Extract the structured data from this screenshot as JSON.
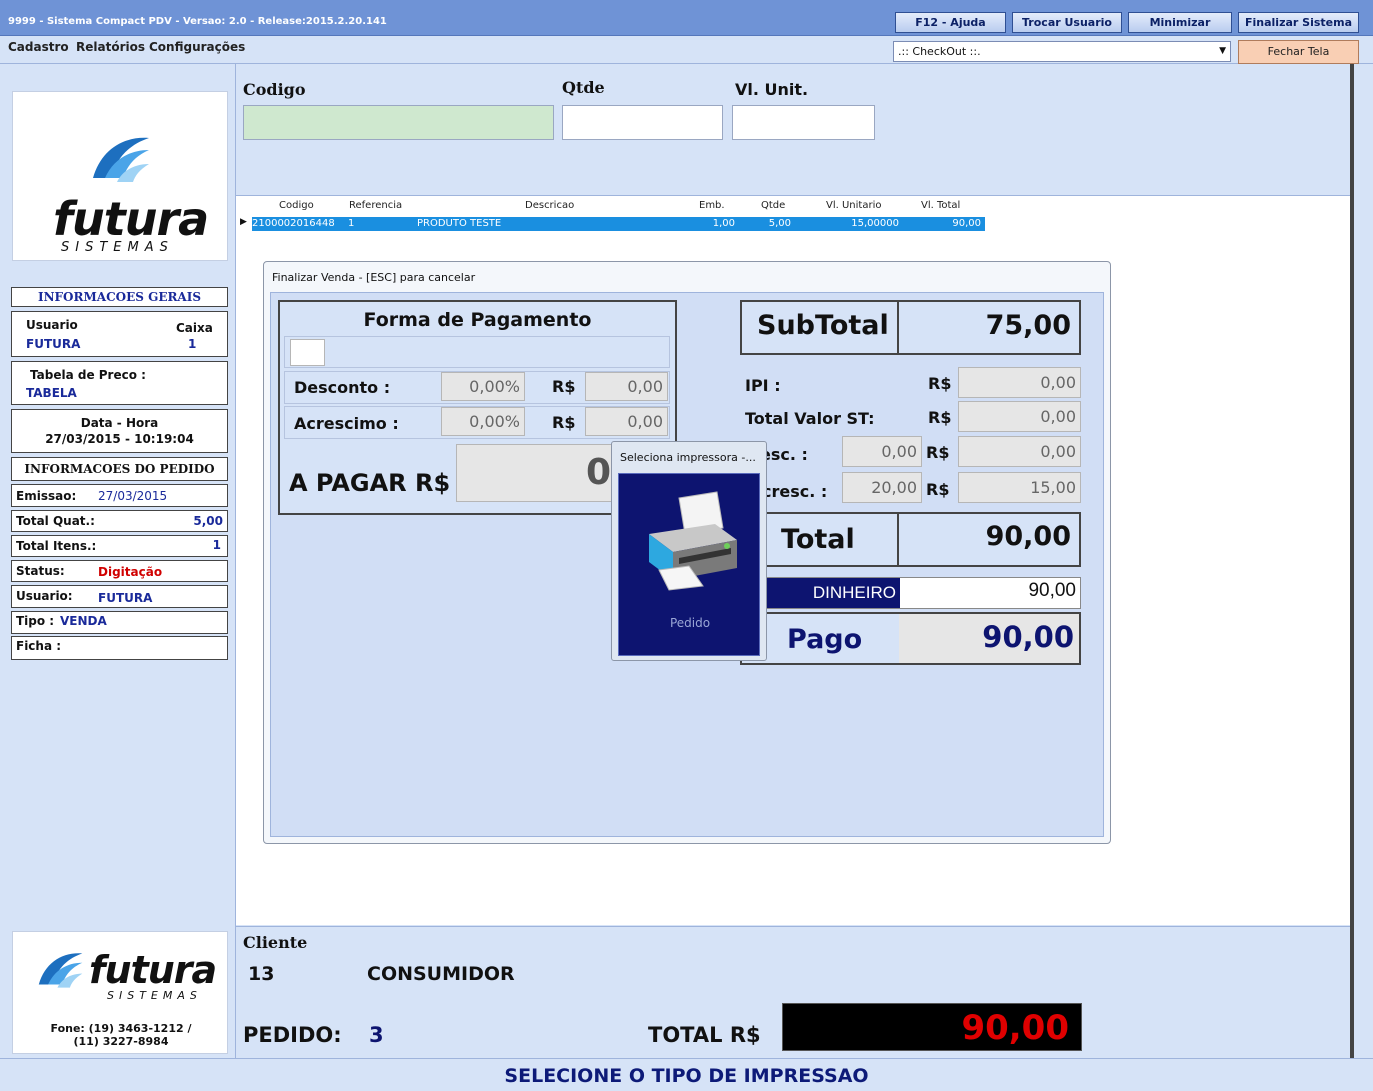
{
  "window": {
    "title": "9999 - Sistema Compact PDV - Versao: 2.0 - Release:2015.2.20.141",
    "buttons": {
      "help": "F12 - Ajuda",
      "switch_user": "Trocar Usuario",
      "minimize": "Minimizar",
      "exit": "Finalizar Sistema"
    }
  },
  "menu": {
    "items": [
      "Cadastro",
      "Relatórios",
      "Configurações"
    ],
    "checkout_select": ".:: CheckOut ::.",
    "close_screen": "Fechar Tela"
  },
  "logo": {
    "word": "futura",
    "sub": "SISTEMAS",
    "phone_line1": "Fone: (19) 3463-1212 /",
    "phone_line2": "(11) 3227-8984"
  },
  "info": {
    "general_header": "INFORMACOES GERAIS",
    "user_label": "Usuario",
    "user_value": "FUTURA",
    "cashier_label": "Caixa",
    "cashier_value": "1",
    "price_table_label": "Tabela de Preco :",
    "price_table_value": "TABELA",
    "datetime_label": "Data - Hora",
    "datetime_value": "27/03/2015 - 10:19:04",
    "order_header": "INFORMACOES DO PEDIDO",
    "issue_label": "Emissao:",
    "issue_value": "27/03/2015",
    "total_qty_label": "Total Quat.:",
    "total_qty_value": "5,00",
    "total_items_label": "Total Itens.:",
    "total_items_value": "1",
    "status_label": "Status:",
    "status_value": "Digitação",
    "user2_label": "Usuario:",
    "user2_value": "FUTURA",
    "type_label": "Tipo :",
    "type_value": "VENDA",
    "card_label": "Ficha :"
  },
  "entry": {
    "code_label": "Codigo",
    "qty_label": "Qtde",
    "unit_label": "Vl. Unit."
  },
  "grid": {
    "headers": [
      "Codigo",
      "Referencia",
      "Descricao",
      "Emb.",
      "Qtde",
      "Vl. Unitario",
      "Vl. Total"
    ],
    "rows": [
      [
        "2100002016448",
        "1",
        "PRODUTO TESTE",
        "1,00",
        "5,00",
        "15,00000",
        "90,00"
      ]
    ]
  },
  "dialog": {
    "title": "Finalizar Venda - [ESC] para cancelar",
    "payment_header": "Forma de Pagamento",
    "discount_label": "Desconto :",
    "discount_pct": "0,00%",
    "discount_currency": "R$",
    "discount_value": "0,00",
    "surcharge_label": "Acrescimo :",
    "surcharge_pct": "0,00%",
    "surcharge_currency": "R$",
    "surcharge_value": "0,00",
    "to_pay_label": "A PAGAR  R$",
    "to_pay_value": "0",
    "subtotal_label": "SubTotal",
    "subtotal_value": "75,00",
    "ipi_label": "IPI :",
    "ipi_currency": "R$",
    "ipi_value": "0,00",
    "st_label": "Total Valor ST:",
    "st_currency": "R$",
    "st_value": "0,00",
    "desc_label": "esc. :",
    "desc_left": "0,00",
    "desc_currency": "R$",
    "desc_right": "0,00",
    "acresc_label": "cresc. :",
    "acresc_left": "20,00",
    "acresc_currency": "R$",
    "acresc_right": "15,00",
    "total_label": "Total",
    "total_value": "90,00",
    "method_label": "DINHEIRO",
    "method_value": "90,00",
    "paid_label": "Pago",
    "paid_value": "90,00"
  },
  "printer_popup": {
    "title": "Seleciona impressora -...",
    "option_label": "Pedido"
  },
  "bottom": {
    "client_label": "Cliente",
    "client_code": "13",
    "client_name": "CONSUMIDOR",
    "order_label": "PEDIDO:",
    "order_value": "3",
    "total_label": "TOTAL R$",
    "total_value": "90,00"
  },
  "status": {
    "message": "SELECIONE O TIPO DE IMPRESSAO"
  }
}
